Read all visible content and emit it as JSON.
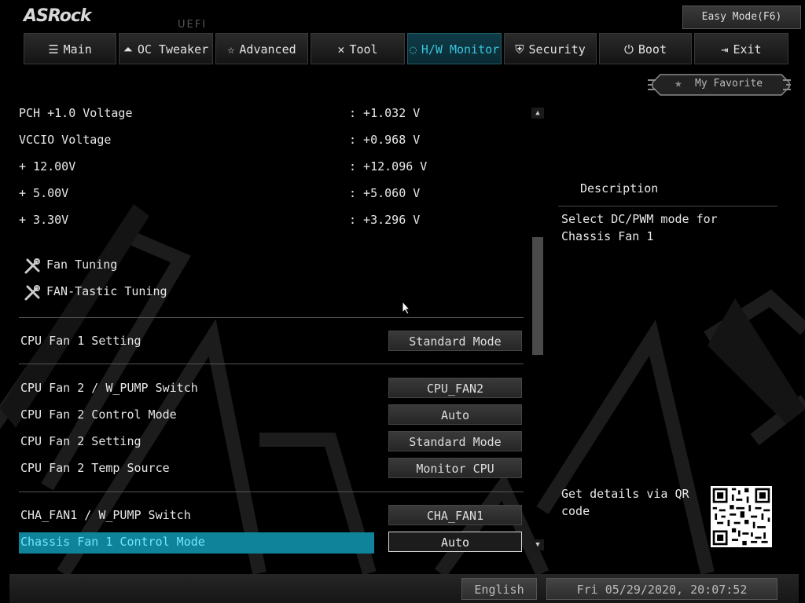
{
  "header": {
    "logo": "ASRock",
    "firmware": "UEFI",
    "easy_mode_label": "Easy Mode(F6)"
  },
  "nav": {
    "tabs": [
      {
        "label": "Main",
        "icon": "list-icon"
      },
      {
        "label": "OC Tweaker",
        "icon": "rocket-icon"
      },
      {
        "label": "Advanced",
        "icon": "star-icon"
      },
      {
        "label": "Tool",
        "icon": "tools-icon"
      },
      {
        "label": "H/W Monitor",
        "icon": "monitor-icon",
        "active": true
      },
      {
        "label": "Security",
        "icon": "shield-icon"
      },
      {
        "label": "Boot",
        "icon": "power-icon"
      },
      {
        "label": "Exit",
        "icon": "exit-icon"
      }
    ]
  },
  "favorite": {
    "label": "My Favorite"
  },
  "readings": [
    {
      "label": "PCH +1.0 Voltage",
      "value": ": +1.032 V"
    },
    {
      "label": "VCCIO Voltage",
      "value": ": +0.968 V"
    },
    {
      "label": "+ 12.00V",
      "value": ": +12.096 V"
    },
    {
      "label": "+ 5.00V",
      "value": ": +5.060 V"
    },
    {
      "label": "+ 3.30V",
      "value": ": +3.296 V"
    }
  ],
  "tools": [
    {
      "label": "Fan Tuning",
      "icon": "wrench-screwdriver-icon"
    },
    {
      "label": "FAN-Tastic Tuning",
      "icon": "wrench-screwdriver-icon"
    }
  ],
  "settings": [
    {
      "label": "CPU Fan 1 Setting",
      "value": "Standard Mode"
    },
    {
      "label": "CPU Fan 2 / W_PUMP Switch",
      "value": "CPU_FAN2"
    },
    {
      "label": "CPU Fan 2 Control Mode",
      "value": "Auto"
    },
    {
      "label": "CPU Fan 2 Setting",
      "value": "Standard Mode"
    },
    {
      "label": "CPU Fan 2 Temp Source",
      "value": "Monitor CPU"
    },
    {
      "label": "CHA_FAN1 / W_PUMP Switch",
      "value": "CHA_FAN1"
    },
    {
      "label": "Chassis Fan 1 Control Mode",
      "value": "Auto",
      "selected": true
    }
  ],
  "description": {
    "title": "Description",
    "text": "Select DC/PWM mode for Chassis Fan 1",
    "qr_text": "Get details via QR code"
  },
  "status": {
    "language": "English",
    "datetime": "Fri 05/29/2020, 20:07:52"
  },
  "colors": {
    "accent": "#38c5dc",
    "highlight": "#0e8399",
    "background": "#000000"
  }
}
